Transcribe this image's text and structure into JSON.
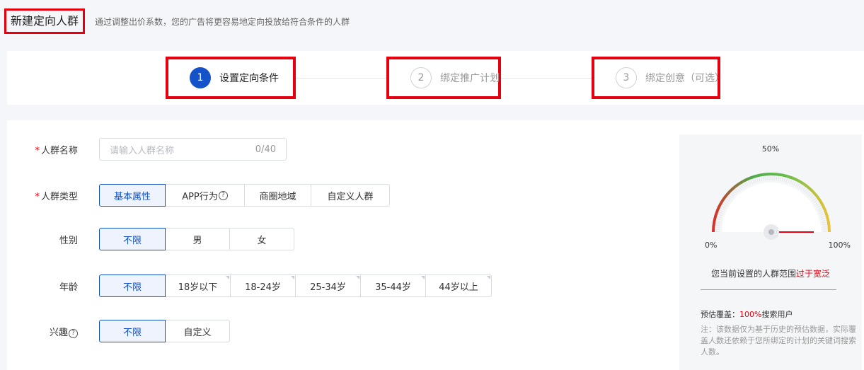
{
  "header": {
    "title": "新建定向人群",
    "description": "通过调整出价系数，您的广告将更容易地定向投放给符合条件的人群"
  },
  "steps": [
    {
      "number": "1",
      "label": "设置定向条件",
      "active": true
    },
    {
      "number": "2",
      "label": "绑定推广计划",
      "active": false
    },
    {
      "number": "3",
      "label": "绑定创意（可选）",
      "active": false
    }
  ],
  "form": {
    "name": {
      "label": "人群名称",
      "placeholder": "请输入人群名称",
      "counter": "0/40"
    },
    "type": {
      "label": "人群类型",
      "options": [
        "基本属性",
        "APP行为",
        "商圈地域",
        "自定义人群"
      ],
      "selected": "基本属性"
    },
    "gender": {
      "label": "性别",
      "options": [
        "不限",
        "男",
        "女"
      ],
      "selected": "不限"
    },
    "age": {
      "label": "年龄",
      "options": [
        "不限",
        "18岁以下",
        "18-24岁",
        "25-34岁",
        "35-44岁",
        "44岁以上"
      ],
      "selected": "不限"
    },
    "interest": {
      "label": "兴趣",
      "options": [
        "不限",
        "自定义"
      ],
      "selected": "不限"
    }
  },
  "gauge": {
    "mid_label": "50%",
    "min_label": "0%",
    "max_label": "100%",
    "value_fraction": 1.0,
    "range_prefix": "您当前设置的人群范围",
    "range_status": "过于宽泛",
    "coverage_label": "预估覆盖：",
    "coverage_value": "100%",
    "coverage_suffix": "搜索用户",
    "note": "注：该数据仅为基于历史的预估数据，实际覆盖人数还依赖于您所绑定的计划的关键词搜索人数。"
  },
  "colors": {
    "accent": "#1452c9",
    "highlight_box": "#e5000f",
    "warning": "#e5000f"
  }
}
